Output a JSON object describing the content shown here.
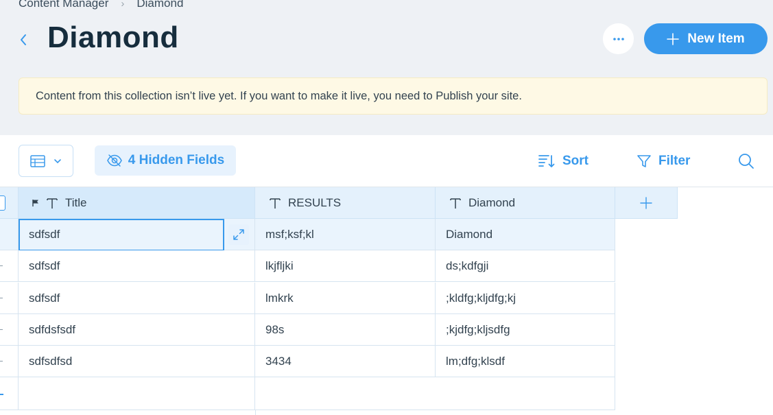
{
  "breadcrumb": {
    "root": "Content Manager",
    "current": "Diamond"
  },
  "page": {
    "title": "Diamond"
  },
  "actions": {
    "more_label": "···",
    "new_item_label": "New Item"
  },
  "notice": {
    "text": "Content from this collection isn’t live yet. If you want to make it live, you need to Publish your site."
  },
  "toolbar": {
    "hidden_fields_label": "4 Hidden Fields",
    "sort_label": "Sort",
    "filter_label": "Filter"
  },
  "table": {
    "columns": [
      {
        "label": "Title",
        "icon": "text-field-icon",
        "primary": true
      },
      {
        "label": "RESULTS",
        "icon": "text-field-icon"
      },
      {
        "label": "Diamond",
        "icon": "text-field-icon"
      }
    ],
    "rows": [
      [
        "sdfsdf",
        "msf;ksf;kl",
        "Diamond"
      ],
      [
        "sdfsdf",
        "lkjfljki",
        "ds;kdfgji"
      ],
      [
        "sdfsdf",
        "lmkrk",
        ";kldfg;kljdfg;kj"
      ],
      [
        "sdfdsfsdf",
        "98s",
        ";kjdfg;kljsdfg"
      ],
      [
        "sdfsdfsd",
        "3434",
        "lm;dfg;klsdf"
      ]
    ]
  },
  "colors": {
    "accent": "#3899ec",
    "header_bg": "#eef1f5",
    "notice_bg": "#fef9e5",
    "text_dark": "#162d3d"
  }
}
